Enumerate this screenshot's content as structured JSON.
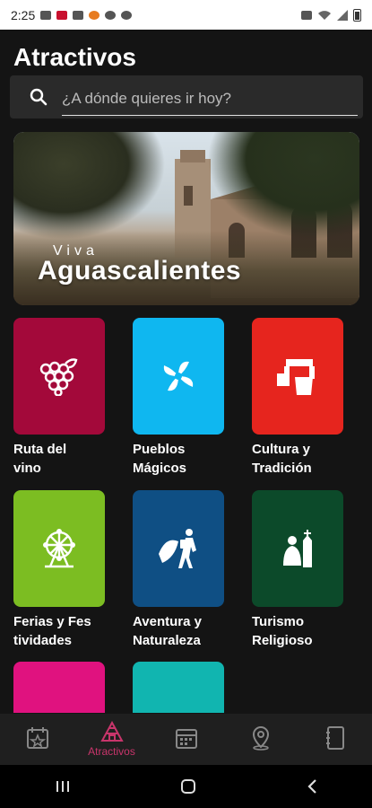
{
  "status_bar": {
    "time": "2:25"
  },
  "header": {
    "title": "Atractivos"
  },
  "search": {
    "placeholder": "¿A dónde quieres ir hoy?"
  },
  "banner": {
    "tagline": "Viva",
    "name": "Aguascalientes"
  },
  "categories": [
    {
      "label_line1": "Ruta del",
      "label_line2": "vino",
      "color": "#a3093a",
      "icon": "grapes-icon"
    },
    {
      "label_line1": "Pueblos",
      "label_line2": "Mágicos",
      "color": "#0fb7f0",
      "icon": "pinwheel-icon"
    },
    {
      "label_line1": "Cultura y",
      "label_line2": "Tradición",
      "color": "#e6251e",
      "icon": "monument-icon"
    },
    {
      "label_line1": "Ferias y Fes",
      "label_line2": "tividades",
      "color": "#7cbd22",
      "icon": "ferris-wheel-icon"
    },
    {
      "label_line1": "Aventura y",
      "label_line2": "Naturaleza",
      "color": "#0f4f84",
      "icon": "hiker-icon"
    },
    {
      "label_line1": "Turismo",
      "label_line2": "Religioso",
      "color": "#0c4a2a",
      "icon": "pilgrim-icon"
    },
    {
      "label_line1": "",
      "label_line2": "",
      "color": "#e0127f",
      "icon": "category-icon"
    },
    {
      "label_line1": "",
      "label_line2": "",
      "color": "#11b5b0",
      "icon": "category-icon"
    }
  ],
  "bottom_nav": {
    "items": [
      {
        "label": "",
        "icon": "calendar-star-icon"
      },
      {
        "label": "Atractivos",
        "icon": "pyramid-icon",
        "active": true
      },
      {
        "label": "",
        "icon": "calendar-grid-icon"
      },
      {
        "label": "",
        "icon": "map-pin-icon"
      },
      {
        "label": "",
        "icon": "phonebook-icon"
      }
    ],
    "active_color": "#c8356b"
  }
}
